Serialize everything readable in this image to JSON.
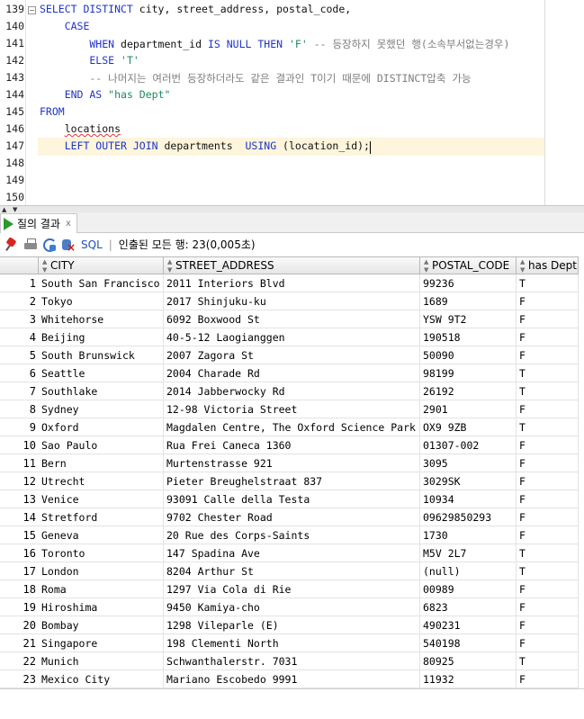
{
  "editor": {
    "line_numbers": [
      "139",
      "140",
      "141",
      "142",
      "143",
      "144",
      "145",
      "146",
      "147",
      "148",
      "149",
      "150"
    ],
    "lines": [
      [
        {
          "t": "SELECT DISTINCT ",
          "c": "kw"
        },
        {
          "t": "city, street_address, postal_code,",
          "c": "id"
        }
      ],
      [
        {
          "t": "    CASE",
          "c": "kw"
        }
      ],
      [
        {
          "t": "        WHEN ",
          "c": "kw"
        },
        {
          "t": "department_id ",
          "c": "id"
        },
        {
          "t": "IS NULL THEN ",
          "c": "kw"
        },
        {
          "t": "'F'",
          "c": "str"
        },
        {
          "t": " -- 등장하지 못했던 행(소속부서없는경우)",
          "c": "cmt"
        }
      ],
      [
        {
          "t": "        ELSE ",
          "c": "kw"
        },
        {
          "t": "'T'",
          "c": "str"
        }
      ],
      [
        {
          "t": "        -- 나머지는 여러번 등장하더라도 같은 결과인 T이기 때문에 DISTINCT압축 가능",
          "c": "cmt"
        }
      ],
      [
        {
          "t": "    END AS ",
          "c": "kw"
        },
        {
          "t": "\"has Dept\"",
          "c": "str"
        }
      ],
      [
        {
          "t": "FROM",
          "c": "kw"
        }
      ],
      [
        {
          "t": "    ",
          "c": "id"
        },
        {
          "t": "locations",
          "c": "id wavy"
        }
      ],
      [
        {
          "t": "    LEFT OUTER JOIN ",
          "c": "kw"
        },
        {
          "t": "departments  ",
          "c": "id"
        },
        {
          "t": "USING ",
          "c": "kw"
        },
        {
          "t": "(location_id);",
          "c": "id"
        }
      ],
      [],
      [],
      []
    ]
  },
  "results_tab": {
    "label": "질의 결과",
    "close": "x"
  },
  "toolbar": {
    "sql_label": "SQL",
    "separator": "|",
    "status": "인출된 모든 행: 23(0,005초)"
  },
  "grid": {
    "columns": [
      "CITY",
      "STREET_ADDRESS",
      "POSTAL_CODE",
      "has Dept"
    ],
    "rows": [
      [
        "1",
        "South San Francisco",
        "2011 Interiors Blvd",
        "99236",
        "T"
      ],
      [
        "2",
        "Tokyo",
        "2017 Shinjuku-ku",
        "1689",
        "F"
      ],
      [
        "3",
        "Whitehorse",
        "6092 Boxwood St",
        "YSW 9T2",
        "F"
      ],
      [
        "4",
        "Beijing",
        "40-5-12 Laogianggen",
        "190518",
        "F"
      ],
      [
        "5",
        "South Brunswick",
        "2007 Zagora St",
        "50090",
        "F"
      ],
      [
        "6",
        "Seattle",
        "2004 Charade Rd",
        "98199",
        "T"
      ],
      [
        "7",
        "Southlake",
        "2014 Jabberwocky Rd",
        "26192",
        "T"
      ],
      [
        "8",
        "Sydney",
        "12-98 Victoria Street",
        "2901",
        "F"
      ],
      [
        "9",
        "Oxford",
        "Magdalen Centre, The Oxford Science Park",
        "OX9 9ZB",
        "T"
      ],
      [
        "10",
        "Sao Paulo",
        "Rua Frei Caneca 1360",
        "01307-002",
        "F"
      ],
      [
        "11",
        "Bern",
        "Murtenstrasse 921",
        "3095",
        "F"
      ],
      [
        "12",
        "Utrecht",
        "Pieter Breughelstraat 837",
        "3029SK",
        "F"
      ],
      [
        "13",
        "Venice",
        "93091 Calle della Testa",
        "10934",
        "F"
      ],
      [
        "14",
        "Stretford",
        "9702 Chester Road",
        "09629850293",
        "F"
      ],
      [
        "15",
        "Geneva",
        "20 Rue des Corps-Saints",
        "1730",
        "F"
      ],
      [
        "16",
        "Toronto",
        "147 Spadina Ave",
        "M5V 2L7",
        "T"
      ],
      [
        "17",
        "London",
        "8204 Arthur St",
        "(null)",
        "T"
      ],
      [
        "18",
        "Roma",
        "1297 Via Cola di Rie",
        "00989",
        "F"
      ],
      [
        "19",
        "Hiroshima",
        "9450 Kamiya-cho",
        "6823",
        "F"
      ],
      [
        "20",
        "Bombay",
        "1298 Vileparle (E)",
        "490231",
        "F"
      ],
      [
        "21",
        "Singapore",
        "198 Clementi North",
        "540198",
        "F"
      ],
      [
        "22",
        "Munich",
        "Schwanthalerstr. 7031",
        "80925",
        "T"
      ],
      [
        "23",
        "Mexico City",
        "Mariano Escobedo 9991",
        "11932",
        "F"
      ]
    ]
  }
}
